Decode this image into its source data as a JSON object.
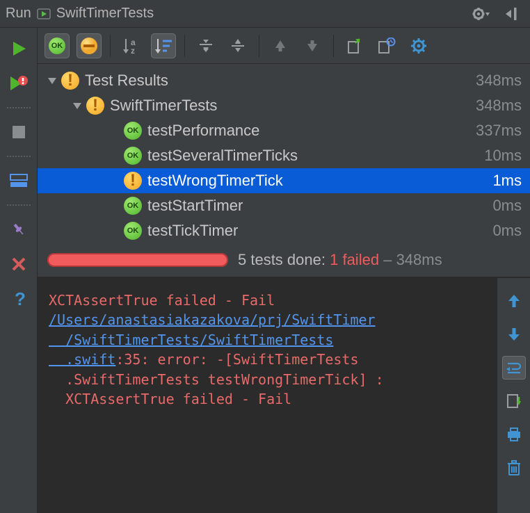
{
  "title": {
    "run_label": "Run",
    "config_name": "SwiftTimerTests"
  },
  "toolbar": {
    "show_passed": "show-passed",
    "show_ignored": "show-ignored"
  },
  "tree": {
    "root": {
      "label": "Test Results",
      "duration": "348ms",
      "status": "warn"
    },
    "suite": {
      "label": "SwiftTimerTests",
      "duration": "348ms",
      "status": "warn"
    },
    "tests": [
      {
        "label": "testPerformance",
        "duration": "337ms",
        "status": "ok"
      },
      {
        "label": "testSeveralTimerTicks",
        "duration": "10ms",
        "status": "ok"
      },
      {
        "label": "testWrongTimerTick",
        "duration": "1ms",
        "status": "warn",
        "selected": true
      },
      {
        "label": "testStartTimer",
        "duration": "0ms",
        "status": "ok"
      },
      {
        "label": "testTickTimer",
        "duration": "0ms",
        "status": "ok"
      }
    ]
  },
  "summary": {
    "tests_done_prefix": "5 tests done:",
    "failed_text": "1 failed",
    "dash": "–",
    "time": "348ms"
  },
  "console": {
    "line1": "XCTAssertTrue failed - Fail",
    "path": "/Users/anastasiakazakova/prj/SwiftTimer",
    "line3": "  /SwiftTimerTests/SwiftTimerTests",
    "swift": "  .swift",
    "line4_rest": ":35: error: -[SwiftTimerTests",
    "line5": "  .SwiftTimerTests testWrongTimerTick] : ",
    "line6": "  XCTAssertTrue failed - Fail"
  }
}
